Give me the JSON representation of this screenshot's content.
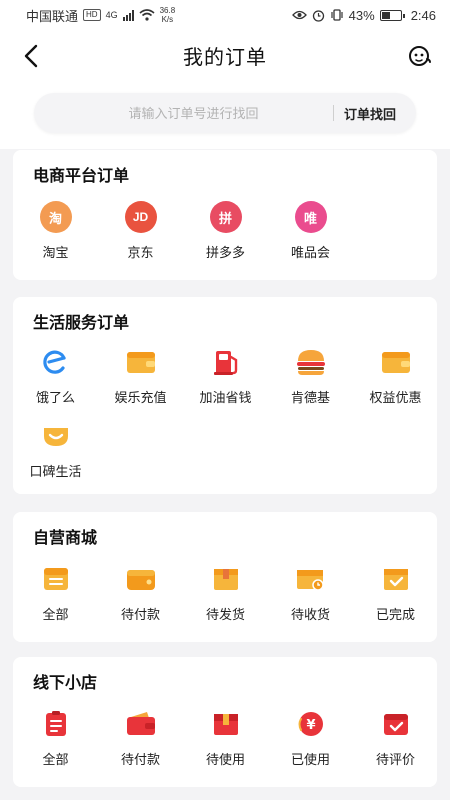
{
  "status_bar": {
    "carrier": "中国联通",
    "hd": "HD",
    "network": "4G",
    "speed_value": "36.8",
    "speed_unit": "K/s",
    "battery": "43%",
    "time": "2:46"
  },
  "header": {
    "title": "我的订单",
    "back_icon": "chevron-left-icon",
    "service_icon": "customer-service-icon"
  },
  "search": {
    "placeholder": "请输入订单号进行找回",
    "button_label": "订单找回"
  },
  "sections": {
    "ecommerce": {
      "title": "电商平台订单",
      "items": [
        {
          "label": "淘宝",
          "glyph": "淘",
          "color": "#f39b52"
        },
        {
          "label": "京东",
          "glyph": "JD",
          "color": "#e9533f"
        },
        {
          "label": "拼多多",
          "glyph": "拼",
          "color": "#e84c62"
        },
        {
          "label": "唯品会",
          "glyph": "唯",
          "color": "#ea4c8e"
        }
      ]
    },
    "life": {
      "title": "生活服务订单",
      "items": [
        {
          "label": "饿了么",
          "icon": "eleme-icon"
        },
        {
          "label": "娱乐充值",
          "icon": "wallet-icon"
        },
        {
          "label": "加油省钱",
          "icon": "gas-pump-icon"
        },
        {
          "label": "肯德基",
          "icon": "burger-icon"
        },
        {
          "label": "权益优惠",
          "icon": "card-icon"
        },
        {
          "label": "口碑生活",
          "icon": "koubei-icon"
        }
      ]
    },
    "mall": {
      "title": "自营商城",
      "items": [
        {
          "label": "全部",
          "icon": "list-icon"
        },
        {
          "label": "待付款",
          "icon": "wallet-icon"
        },
        {
          "label": "待发货",
          "icon": "box-icon"
        },
        {
          "label": "待收货",
          "icon": "truck-box-icon"
        },
        {
          "label": "已完成",
          "icon": "check-box-icon"
        }
      ]
    },
    "store": {
      "title": "线下小店",
      "items": [
        {
          "label": "全部",
          "icon": "list-icon"
        },
        {
          "label": "待付款",
          "icon": "wallet-icon"
        },
        {
          "label": "待使用",
          "icon": "gift-box-icon"
        },
        {
          "label": "已使用",
          "icon": "yen-coin-icon"
        },
        {
          "label": "待评价",
          "icon": "check-box-icon"
        }
      ]
    }
  },
  "colors": {
    "orange": "#f6b53b",
    "orange_dark": "#ef8b1f",
    "red": "#e8343a",
    "blue": "#2d8cf0",
    "page_bg": "#f3f3f5"
  }
}
